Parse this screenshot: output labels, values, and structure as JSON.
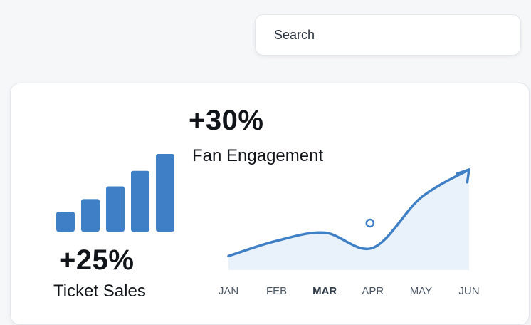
{
  "search": {
    "placeholder": "Search"
  },
  "ticket_sales": {
    "value": "+25%",
    "label": "Ticket Sales"
  },
  "fan_engagement": {
    "value": "+30%",
    "label": "Fan Engagement"
  },
  "colors": {
    "accent": "#3f7fc6",
    "area_fill": "#e9f1fb"
  },
  "chart_data": [
    {
      "type": "bar",
      "values": [
        28,
        46,
        64,
        86,
        110
      ],
      "ylim": [
        0,
        115
      ]
    },
    {
      "type": "line",
      "categories": [
        "JAN",
        "FEB",
        "MAR",
        "APR",
        "MAY",
        "JUN"
      ],
      "highlighted": "MAR",
      "values": [
        12,
        25,
        32,
        19,
        62,
        86
      ],
      "ylim": [
        0,
        100
      ],
      "marker_month": "APR"
    }
  ]
}
